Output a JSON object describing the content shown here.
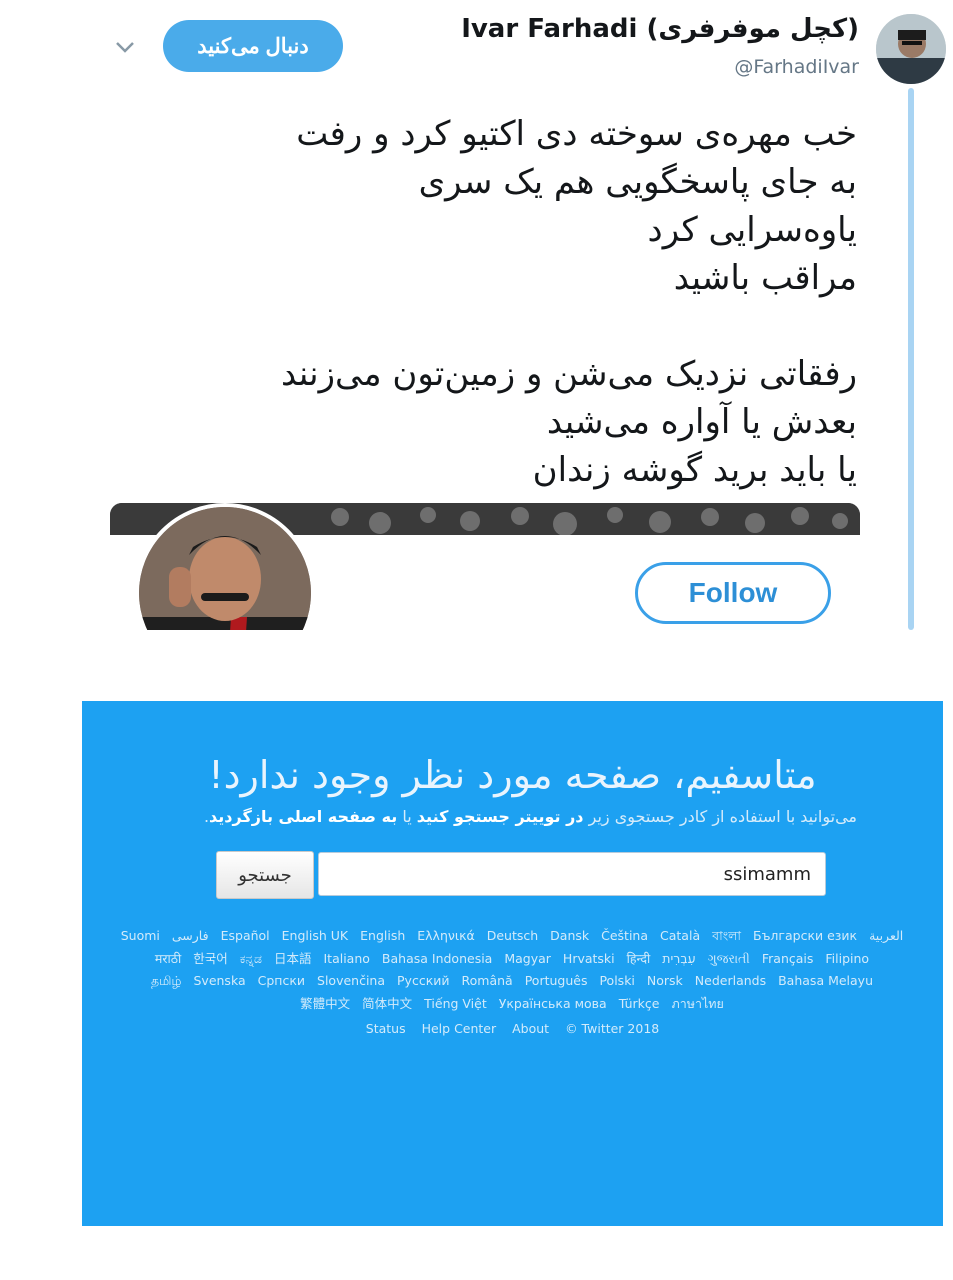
{
  "tweet": {
    "display_name": "Ivar Farhadi (کچل موفرفری)",
    "handle": "@FarhadiIvar",
    "follow_label_fa": "دنبال می‌کنید",
    "lines": [
      "خب مهره‌ی سوخته دی اکتیو کرد و رفت",
      "به جای پاسخگویی هم یک سری",
      "یاوه‌سرایی کرد",
      "مراقب باشید",
      "",
      "رفقاتی نزدیک می‌شن و زمین‌تون می‌زنند",
      "بعدش یا آواره می‌شید",
      "یا باید برید گوشه زندان"
    ],
    "card": {
      "follow_label": "Follow"
    }
  },
  "error_page": {
    "title": "متاسفیم، صفحه مورد نظر وجود ندارد!",
    "subtitle_part1": "می‌توانید با استفاده از کادر جستجوی زیر",
    "subtitle_link1": "در توییتر جستجو کنید",
    "subtitle_part2": "یا",
    "subtitle_link2": "به صفحه اصلی بازگردید",
    "search_button": "جستجو",
    "search_value": "ssimamm",
    "languages": [
      [
        "Suomi",
        "فارسی",
        "Español",
        "English UK",
        "English",
        "Ελληνικά",
        "Deutsch",
        "Dansk",
        "Čeština",
        "Català",
        "বাংলা",
        "Български език",
        "العربية"
      ],
      [
        "मराठी",
        "한국어",
        "ಕನ್ನಡ",
        "日本語",
        "Italiano",
        "Bahasa Indonesia",
        "Magyar",
        "Hrvatski",
        "हिन्दी",
        "עִבְרִית",
        "ગુજરાતી",
        "Français",
        "Filipino"
      ],
      [
        "தமிழ்",
        "Svenska",
        "Српски",
        "Slovenčina",
        "Русский",
        "Română",
        "Português",
        "Polski",
        "Norsk",
        "Nederlands",
        "Bahasa Melayu"
      ],
      [
        "繁體中文",
        "简体中文",
        "Tiếng Việt",
        "Українська мова",
        "Türkçe",
        "ภาษาไทย"
      ]
    ],
    "footer": [
      "Status",
      "Help Center",
      "About",
      "© Twitter 2018"
    ]
  },
  "colors": {
    "accent": "#1da1f2",
    "follow_fill": "#4aabea",
    "rail": "#a9d4f3"
  }
}
